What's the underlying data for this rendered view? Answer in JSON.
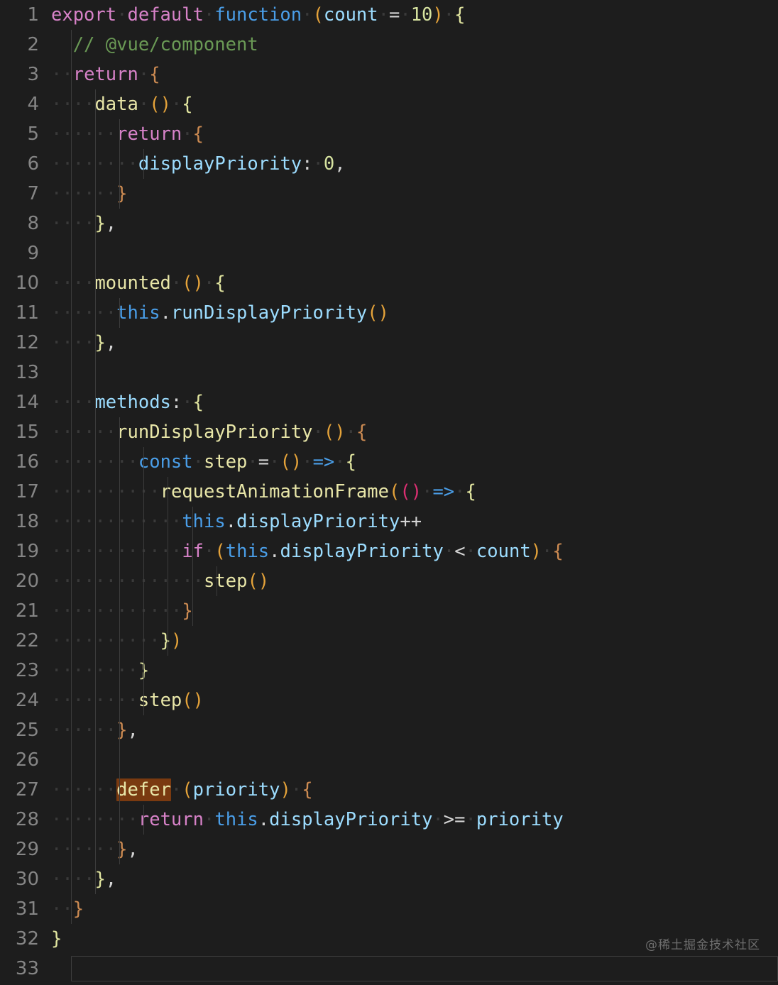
{
  "editor": {
    "background": "#1d1d1d",
    "gutter_color": "#858585",
    "total_lines": 33,
    "current_line": 33,
    "search_match_term": "defer",
    "search_match_color": "#7a3a10",
    "language": "javascript",
    "indent_char": "middot"
  },
  "watermark": {
    "text": "@稀土掘金技术社区"
  },
  "lines": [
    {
      "n": "1",
      "indent": 0,
      "text": "export default function (count = 10) {"
    },
    {
      "n": "2",
      "indent": 2,
      "text": "// @vue/component"
    },
    {
      "n": "3",
      "indent": 2,
      "text": "return {"
    },
    {
      "n": "4",
      "indent": 4,
      "text": "data () {"
    },
    {
      "n": "5",
      "indent": 6,
      "text": "return {"
    },
    {
      "n": "6",
      "indent": 8,
      "text": "displayPriority: 0,"
    },
    {
      "n": "7",
      "indent": 6,
      "text": "}"
    },
    {
      "n": "8",
      "indent": 4,
      "text": "},"
    },
    {
      "n": "9",
      "indent": 0,
      "text": ""
    },
    {
      "n": "10",
      "indent": 4,
      "text": "mounted () {"
    },
    {
      "n": "11",
      "indent": 6,
      "text": "this.runDisplayPriority()"
    },
    {
      "n": "12",
      "indent": 4,
      "text": "},"
    },
    {
      "n": "13",
      "indent": 0,
      "text": ""
    },
    {
      "n": "14",
      "indent": 4,
      "text": "methods: {"
    },
    {
      "n": "15",
      "indent": 6,
      "text": "runDisplayPriority () {"
    },
    {
      "n": "16",
      "indent": 8,
      "text": "const step = () => {"
    },
    {
      "n": "17",
      "indent": 10,
      "text": "requestAnimationFrame(() => {"
    },
    {
      "n": "18",
      "indent": 12,
      "text": "this.displayPriority++"
    },
    {
      "n": "19",
      "indent": 12,
      "text": "if (this.displayPriority < count) {"
    },
    {
      "n": "20",
      "indent": 14,
      "text": "step()"
    },
    {
      "n": "21",
      "indent": 12,
      "text": "}"
    },
    {
      "n": "22",
      "indent": 10,
      "text": "})"
    },
    {
      "n": "23",
      "indent": 8,
      "text": "}"
    },
    {
      "n": "24",
      "indent": 8,
      "text": "step()"
    },
    {
      "n": "25",
      "indent": 6,
      "text": "},"
    },
    {
      "n": "26",
      "indent": 0,
      "text": ""
    },
    {
      "n": "27",
      "indent": 6,
      "text": "defer (priority) {"
    },
    {
      "n": "28",
      "indent": 8,
      "text": "return this.displayPriority >= priority"
    },
    {
      "n": "29",
      "indent": 6,
      "text": "},"
    },
    {
      "n": "30",
      "indent": 4,
      "text": "},"
    },
    {
      "n": "31",
      "indent": 2,
      "text": "}"
    },
    {
      "n": "32",
      "indent": 0,
      "text": "}"
    },
    {
      "n": "33",
      "indent": 0,
      "text": ""
    }
  ]
}
